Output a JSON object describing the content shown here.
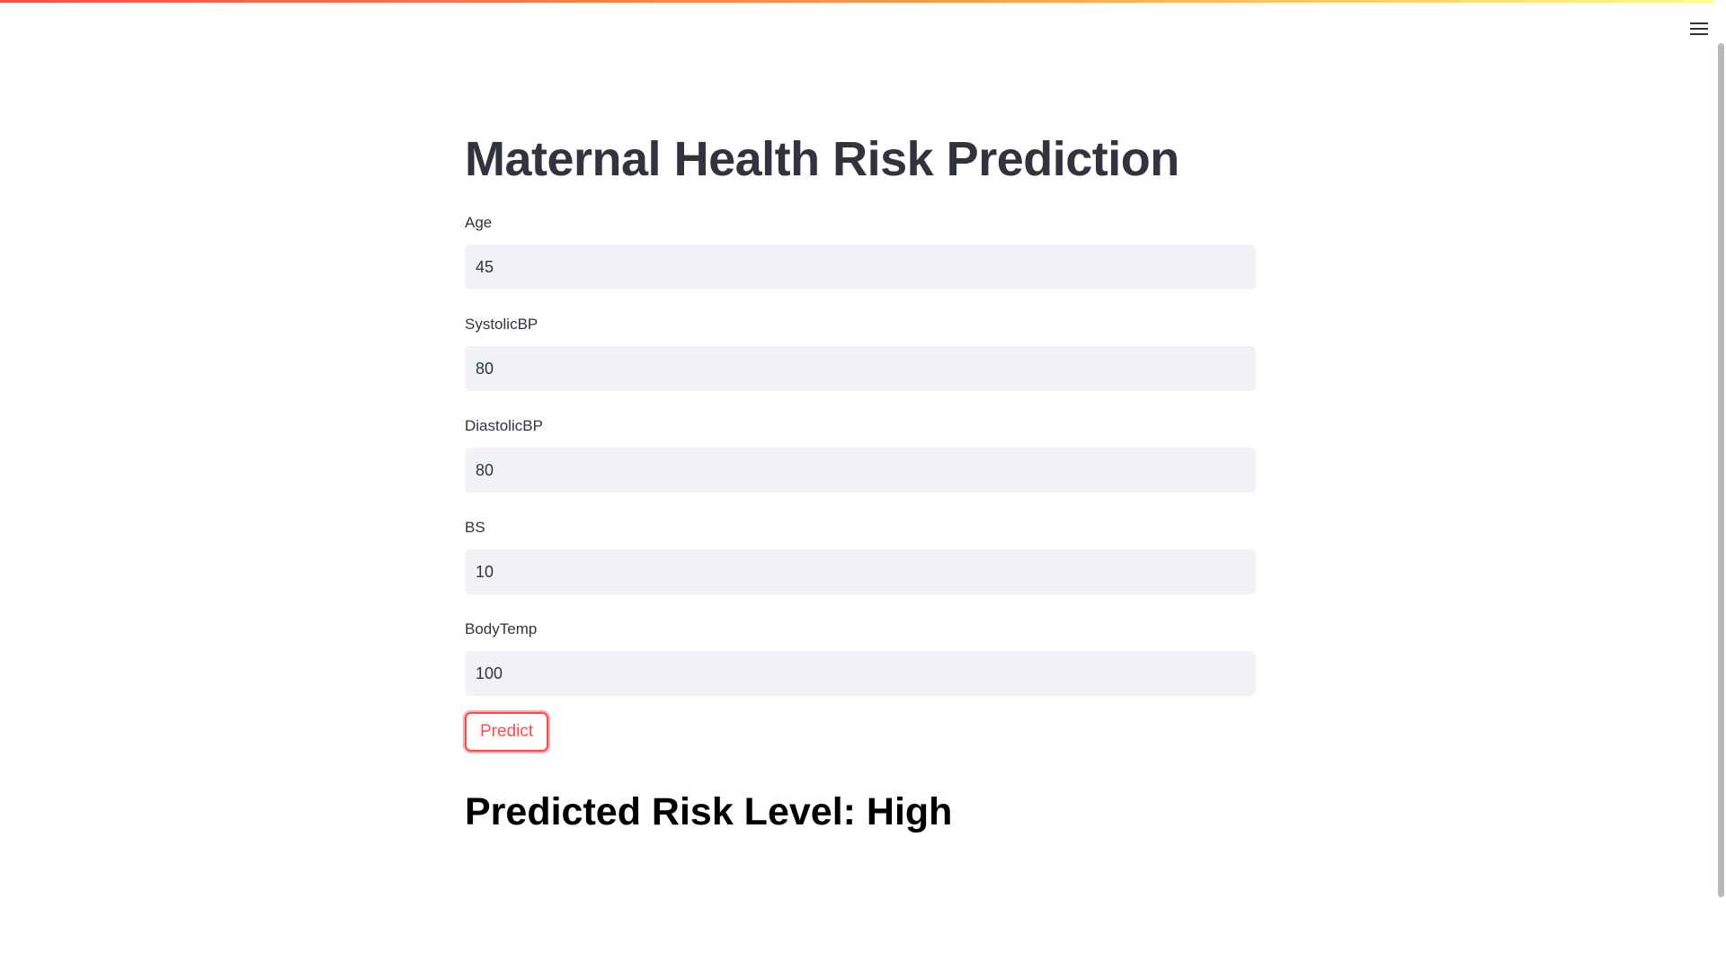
{
  "app": {
    "title": "Maternal Health Risk Prediction",
    "accent_color": "#ff4b4b",
    "menu_icon": "hamburger-menu-icon"
  },
  "form": {
    "fields": [
      {
        "label": "Age",
        "value": "45"
      },
      {
        "label": "SystolicBP",
        "value": "80"
      },
      {
        "label": "DiastolicBP",
        "value": "80"
      },
      {
        "label": "BS",
        "value": "10"
      },
      {
        "label": "BodyTemp",
        "value": "100"
      }
    ],
    "submit_label": "Predict"
  },
  "result": {
    "text": "Predicted Risk Level: High"
  }
}
